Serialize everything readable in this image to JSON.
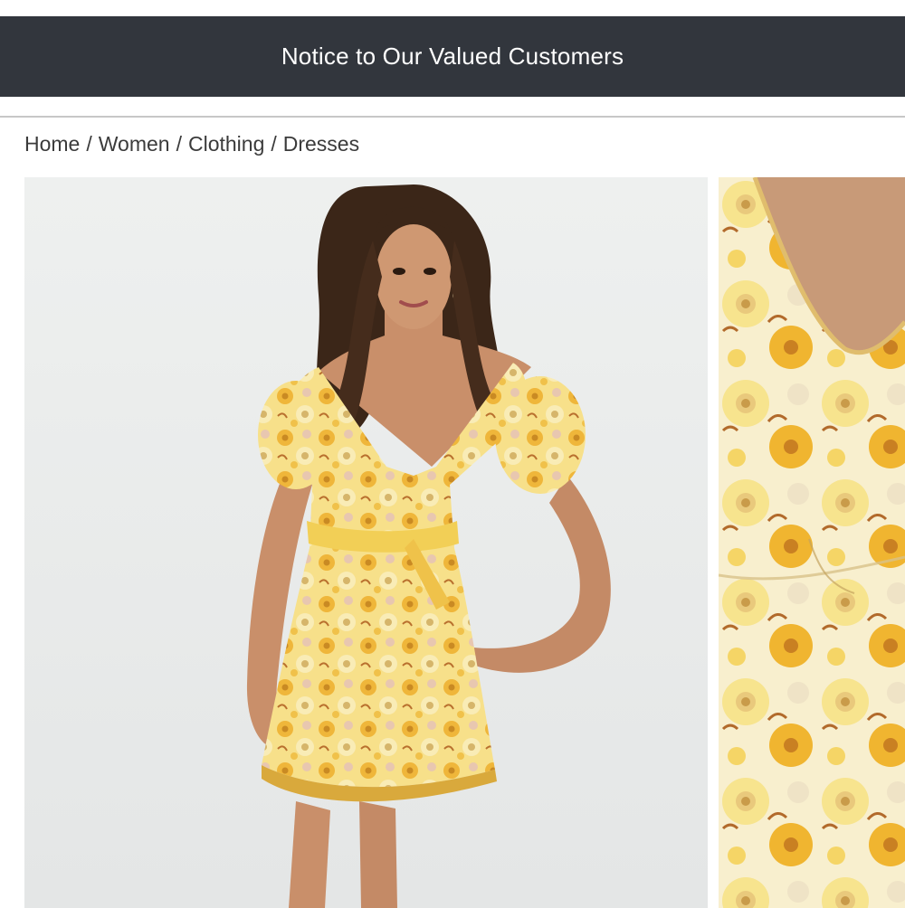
{
  "notice": {
    "label": "Notice to Our Valued Customers"
  },
  "breadcrumb": {
    "items": [
      "Home",
      "Women",
      "Clothing",
      "Dresses"
    ],
    "separator": "/"
  },
  "gallery": {
    "images": [
      {
        "name": "product-image-main",
        "subject": "model wearing yellow floral wrap mini dress"
      },
      {
        "name": "product-image-detail",
        "subject": "close-up of floral print fabric"
      }
    ]
  },
  "colors": {
    "notice_bg": "#32363d",
    "dress_yellow": "#f4d35e",
    "flower_orange": "#e9a52c",
    "image_bg": "#eceded"
  }
}
